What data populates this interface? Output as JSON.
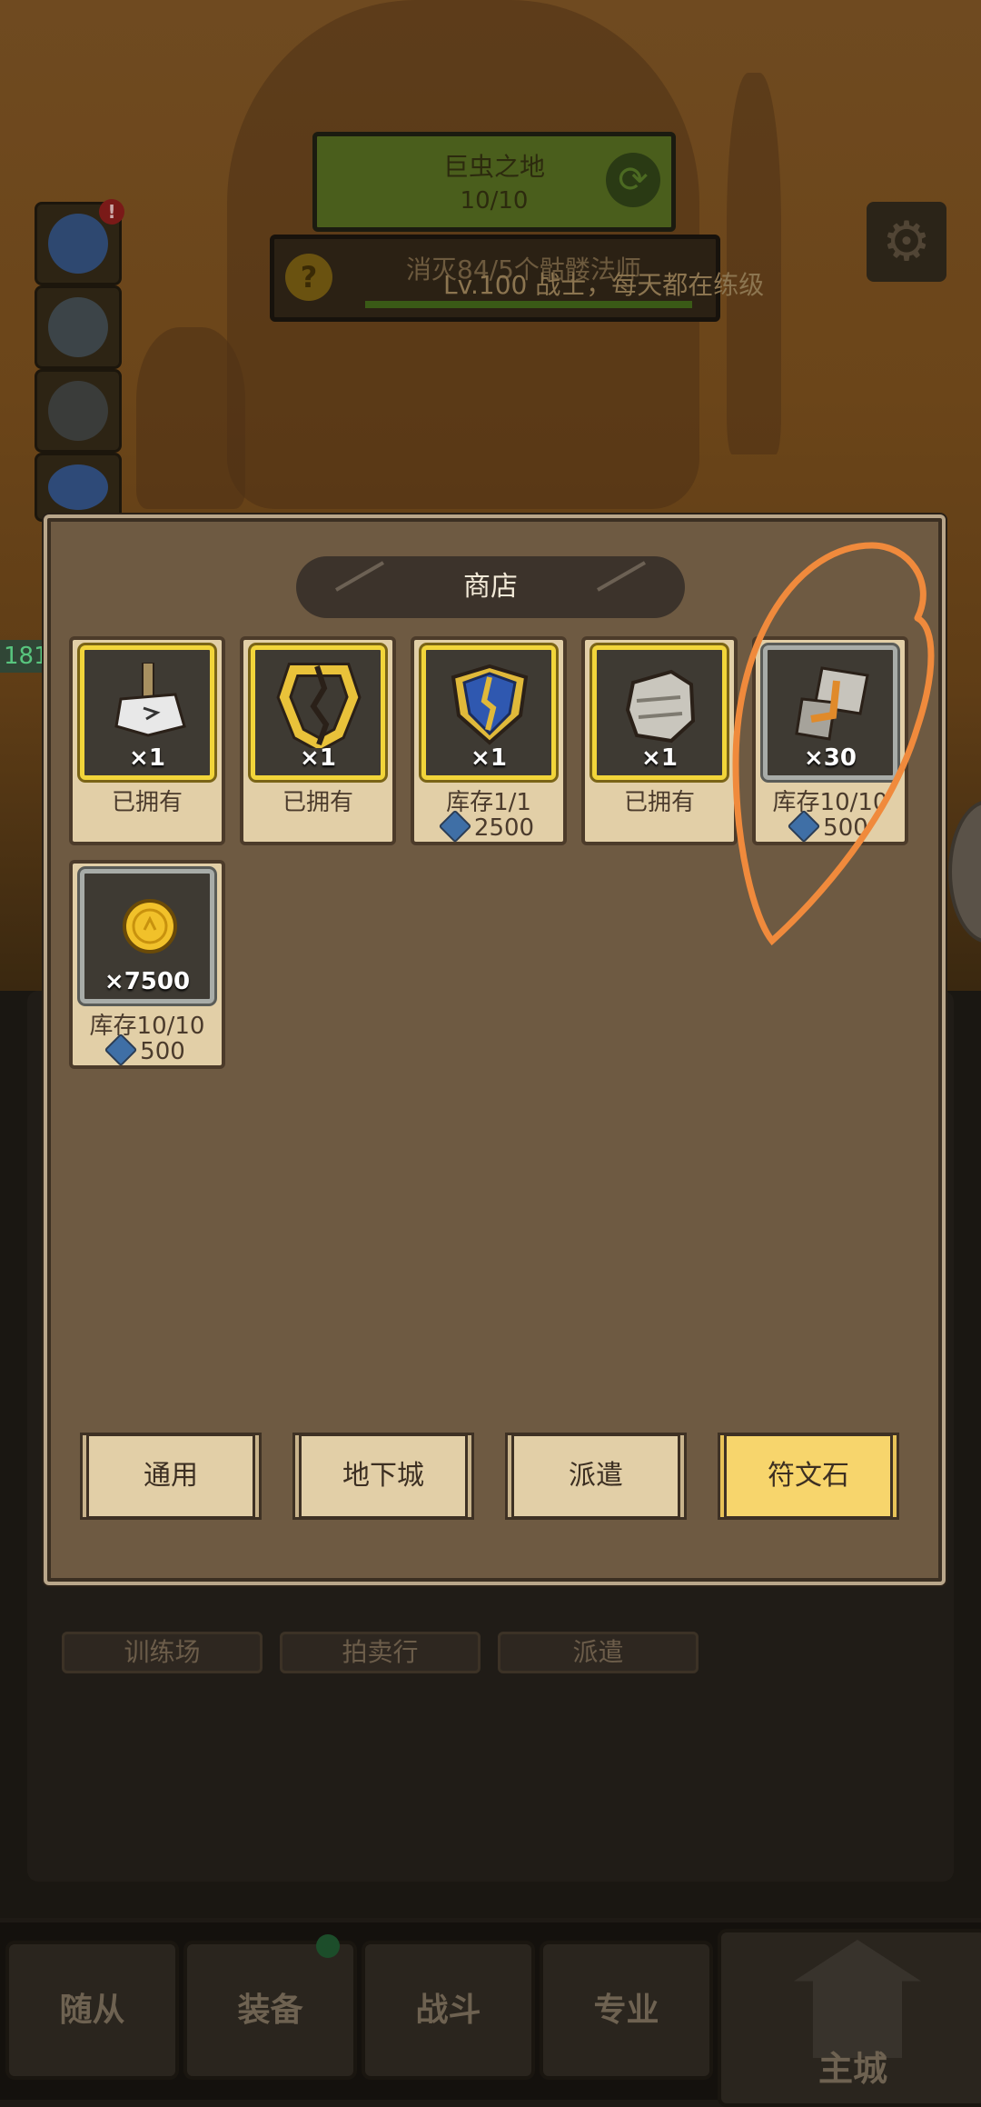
{
  "zone": {
    "name": "巨虫之地",
    "progress": "10/10"
  },
  "quest": {
    "icon": "question-icon",
    "text": "消灭84/5个骷髅法师"
  },
  "player_line": "Lv.100 战士，每天都在练级",
  "left_badge": "181",
  "side_buttons": [
    "star-icon",
    "rock-icon",
    "helmet-icon",
    "house-icon"
  ],
  "side_alert": "!",
  "shop": {
    "title": "商店",
    "items": [
      {
        "icon": "axe-icon",
        "qty": "×1",
        "status": "已拥有",
        "price": "",
        "frame": "gold"
      },
      {
        "icon": "cracked-shield-icon",
        "qty": "×1",
        "status": "已拥有",
        "price": "",
        "frame": "gold"
      },
      {
        "icon": "blue-shield-icon",
        "qty": "×1",
        "status": "库存1/1",
        "price": "2500",
        "frame": "gold"
      },
      {
        "icon": "stone-fist-icon",
        "qty": "×1",
        "status": "已拥有",
        "price": "",
        "frame": "gold"
      },
      {
        "icon": "rune-stone-icon",
        "qty": "×30",
        "status": "库存10/10",
        "price": "500",
        "frame": "silver"
      },
      {
        "icon": "gold-coin-icon",
        "qty": "×7500",
        "status": "库存10/10",
        "price": "500",
        "frame": "silver"
      }
    ],
    "tabs": [
      {
        "label": "通用",
        "active": false
      },
      {
        "label": "地下城",
        "active": false
      },
      {
        "label": "派遣",
        "active": false
      },
      {
        "label": "符文石",
        "active": true
      }
    ]
  },
  "buildings": [
    "训练场",
    "拍卖行",
    "派遣"
  ],
  "bottom_nav": [
    "随从",
    "装备",
    "战斗",
    "专业",
    "主城"
  ],
  "colors": {
    "accent": "#f7d56c",
    "annotation": "#f08a3c",
    "gem": "#3f6fa6"
  }
}
